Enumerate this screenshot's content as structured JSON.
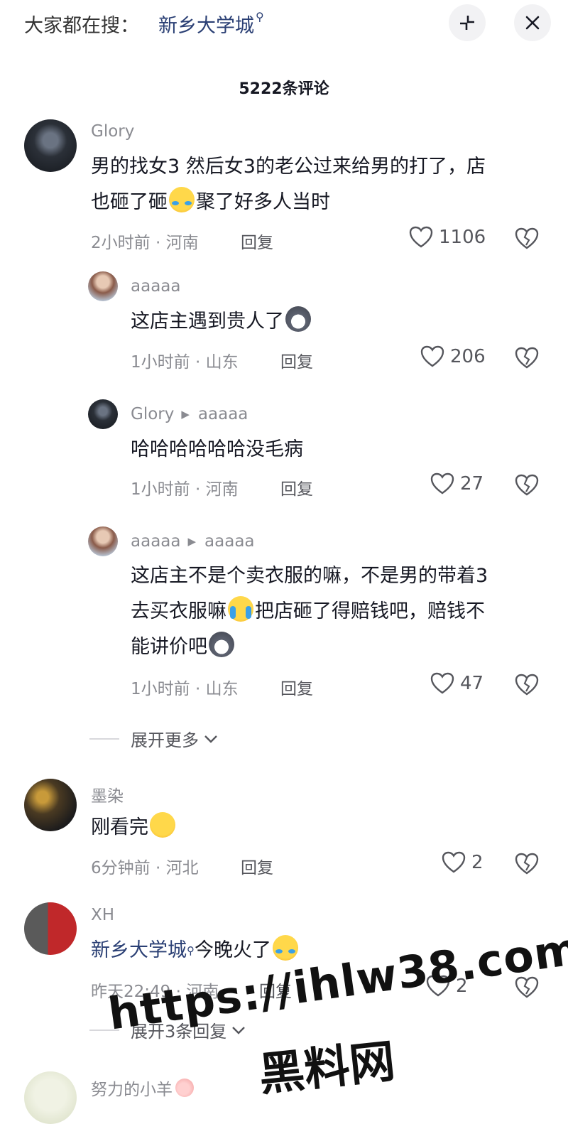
{
  "top_bar": {
    "search_prefix": "大家都在搜：",
    "search_term": "新乡大学城",
    "search_glyph": "⚲"
  },
  "comment_count": "5222条评论",
  "comments": [
    {
      "user": "Glory",
      "text_lines": [
        "男的找女3 然后女3的老公过来给男的打了，店",
        "也砸了砸",
        "聚了好多人当时"
      ],
      "time": "2小时前",
      "location": "河南",
      "reply_label": "回复",
      "likes": "1106"
    },
    {
      "user": "aaaaa",
      "text": "这店主遇到贵人了",
      "time": "1小时前",
      "location": "山东",
      "reply_label": "回复",
      "likes": "206"
    },
    {
      "user": "Glory",
      "reply_to": "aaaaa",
      "text": "哈哈哈哈哈哈没毛病",
      "time": "1小时前",
      "location": "河南",
      "reply_label": "回复",
      "likes": "27"
    },
    {
      "user": "aaaaa",
      "reply_to": "aaaaa",
      "text_lines": [
        "这店主不是个卖衣服的嘛，不是男的带着3",
        "去买衣服嘛",
        "把店砸了得赔钱吧，赔钱不",
        "能讲价吧"
      ],
      "time": "1小时前",
      "location": "山东",
      "reply_label": "回复",
      "likes": "47"
    },
    {
      "user": "墨染",
      "text": "刚看完",
      "time": "6分钟前",
      "location": "河北",
      "reply_label": "回复",
      "likes": "2"
    },
    {
      "user": "XH",
      "link_text": "新乡大学城",
      "text": "今晚火了",
      "time": "昨天22:49",
      "location": "河南",
      "reply_label": "回复",
      "likes": "2"
    },
    {
      "user": "努力的小羊"
    }
  ],
  "expand_label": "展开更多",
  "expand_label_2": "展开3条回复",
  "meta_separator": "·",
  "watermark": {
    "line1": "https://ihlw38.com",
    "line2": "黑料网"
  },
  "colors": {
    "text": "#161823",
    "muted": "#8a8b91",
    "link": "#2a3f74"
  },
  "icons": [
    "collapse-icon",
    "close-icon",
    "heart-icon",
    "broken-heart-icon",
    "chevron-down-icon"
  ]
}
